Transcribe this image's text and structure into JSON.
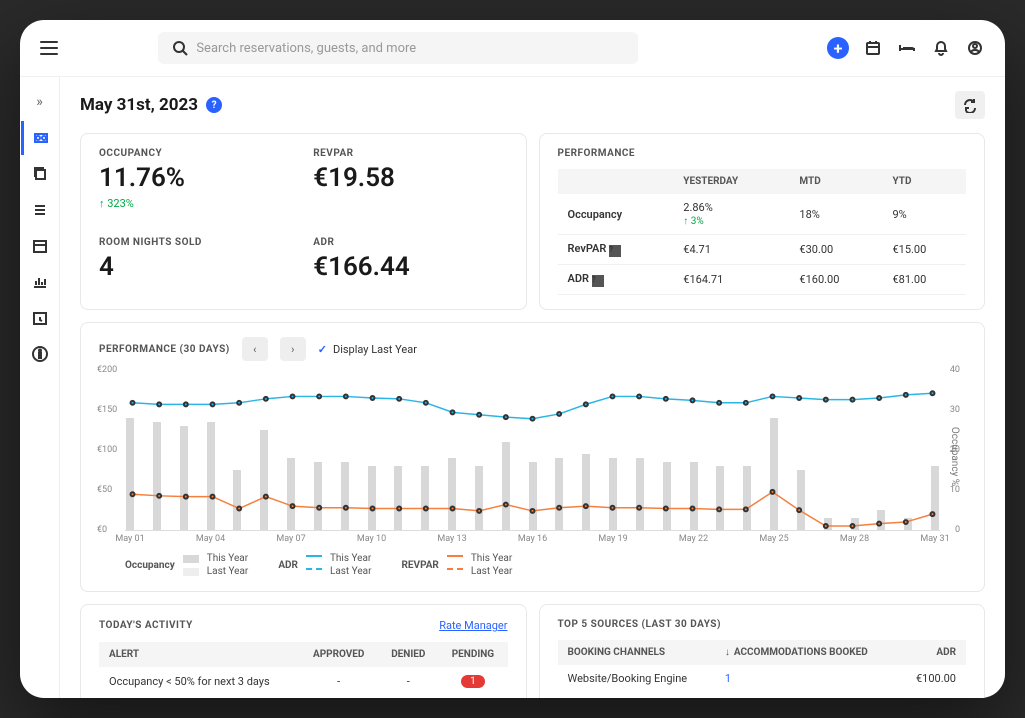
{
  "search": {
    "placeholder": "Search reservations, guests, and more"
  },
  "page": {
    "date": "May 31st, 2023"
  },
  "kpi": {
    "occupancy": {
      "label": "OCCUPANCY",
      "value": "11.76%",
      "delta": "↑ 323%"
    },
    "revpar": {
      "label": "REVPAR",
      "value": "€19.58"
    },
    "rns": {
      "label": "ROOM NIGHTS SOLD",
      "value": "4"
    },
    "adr": {
      "label": "ADR",
      "value": "€166.44"
    }
  },
  "performance": {
    "title": "PERFORMANCE",
    "cols": {
      "c0": "",
      "c1": "YESTERDAY",
      "c2": "MTD",
      "c3": "YTD"
    },
    "rows": {
      "occ": {
        "label": "Occupancy",
        "yesterday": "2.86%",
        "yesterday_delta": "↑ 3%",
        "mtd": "18%",
        "ytd": "9%"
      },
      "revpar": {
        "label": "RevPAR",
        "yesterday": "€4.71",
        "mtd": "€30.00",
        "ytd": "€15.00"
      },
      "adr": {
        "label": "ADR",
        "yesterday": "€164.71",
        "mtd": "€160.00",
        "ytd": "€81.00"
      }
    }
  },
  "chart": {
    "title": "PERFORMANCE (30 DAYS)",
    "toggle": "Display Last Year",
    "ylabel_r": "Occupancy %",
    "legend": {
      "occ": "Occupancy",
      "adr": "ADR",
      "revpar": "REVPAR",
      "ty": "This Year",
      "ly": "Last Year"
    }
  },
  "chart_data": {
    "type": "combo",
    "x": [
      "May 01",
      "May 02",
      "May 03",
      "May 04",
      "May 05",
      "May 06",
      "May 07",
      "May 08",
      "May 09",
      "May 10",
      "May 11",
      "May 12",
      "May 13",
      "May 14",
      "May 15",
      "May 16",
      "May 17",
      "May 18",
      "May 19",
      "May 20",
      "May 21",
      "May 22",
      "May 23",
      "May 24",
      "May 25",
      "May 26",
      "May 27",
      "May 28",
      "May 29",
      "May 30",
      "May 31"
    ],
    "xticks": [
      "May 01",
      "May 04",
      "May 07",
      "May 10",
      "May 13",
      "May 16",
      "May 19",
      "May 22",
      "May 25",
      "May 28",
      "May 31"
    ],
    "y_left": {
      "label": "€",
      "min": 0,
      "max": 200,
      "ticks": [
        0,
        50,
        100,
        150,
        200
      ]
    },
    "y_right": {
      "label": "Occupancy %",
      "min": 0,
      "max": 40,
      "ticks": [
        0,
        10,
        20,
        30,
        40
      ]
    },
    "series": [
      {
        "name": "Occupancy This Year",
        "type": "bar",
        "axis": "right",
        "values": [
          28,
          27,
          26,
          27,
          15,
          25,
          18,
          17,
          17,
          16,
          16,
          16,
          18,
          16,
          22,
          17,
          18,
          19,
          18,
          18,
          17,
          17,
          16,
          16,
          28,
          15,
          3,
          3,
          5,
          3,
          16
        ]
      },
      {
        "name": "ADR This Year",
        "type": "line",
        "axis": "left",
        "color": "#29b6e6",
        "values": [
          160,
          158,
          158,
          158,
          160,
          165,
          168,
          168,
          168,
          166,
          165,
          160,
          148,
          145,
          142,
          140,
          146,
          158,
          168,
          168,
          165,
          163,
          160,
          160,
          168,
          166,
          164,
          164,
          166,
          170,
          172
        ]
      },
      {
        "name": "REVPAR This Year",
        "type": "line",
        "axis": "left",
        "color": "#f5803e",
        "values": [
          45,
          43,
          42,
          42,
          27,
          42,
          30,
          28,
          28,
          27,
          27,
          27,
          27,
          24,
          32,
          24,
          28,
          30,
          28,
          28,
          27,
          27,
          26,
          26,
          48,
          25,
          5,
          5,
          8,
          10,
          20
        ]
      }
    ]
  },
  "activity": {
    "title": "TODAY'S ACTIVITY",
    "link": "Rate Manager",
    "cols": {
      "alert": "ALERT",
      "approved": "APPROVED",
      "denied": "DENIED",
      "pending": "PENDING"
    },
    "row": {
      "alert": "Occupancy < 50% for next 3 days",
      "approved": "-",
      "denied": "-",
      "pending": "1"
    }
  },
  "sources": {
    "title": "TOP 5 SOURCES (LAST 30 DAYS)",
    "cols": {
      "channel": "BOOKING CHANNELS",
      "booked": "ACCOMMODATIONS BOOKED",
      "adr": "ADR"
    },
    "row": {
      "channel": "Website/Booking Engine",
      "booked": "1",
      "adr": "€100.00"
    }
  }
}
